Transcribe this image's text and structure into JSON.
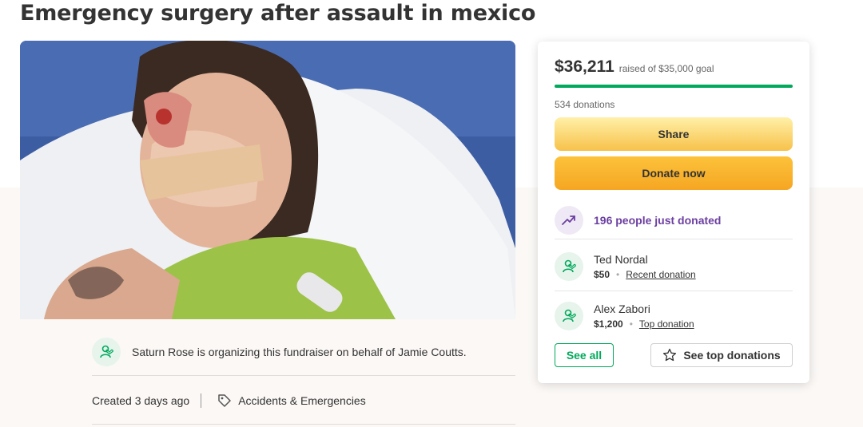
{
  "page": {
    "title": "Emergency surgery after assault in mexico"
  },
  "organizer": {
    "text": "Saturn Rose is organizing this fundraiser on behalf of Jamie Coutts."
  },
  "meta": {
    "created": "Created 3 days ago",
    "category": "Accidents & Emergencies"
  },
  "card": {
    "amount": "$36,211",
    "goal_text": "raised of $35,000 goal",
    "progress_fraction": 1.0,
    "donation_count": "534 donations",
    "share_label": "Share",
    "donate_label": "Donate now",
    "trending_text": "196 people just donated",
    "donors": [
      {
        "name": "Ted Nordal",
        "amount": "$50",
        "tag": "Recent donation"
      },
      {
        "name": "Alex Zabori",
        "amount": "$1,200",
        "tag": "Top donation"
      }
    ],
    "see_all_label": "See all",
    "see_top_label": "See top donations"
  },
  "colors": {
    "accent_green": "#02a95c",
    "trending_purple": "#6b3fa0",
    "button_orange": "#f5a623"
  },
  "icons": {
    "organizer": "user-heart-icon",
    "category": "tag-icon",
    "trending": "trending-up-icon",
    "donor": "user-heart-icon",
    "see_top": "star-icon"
  }
}
